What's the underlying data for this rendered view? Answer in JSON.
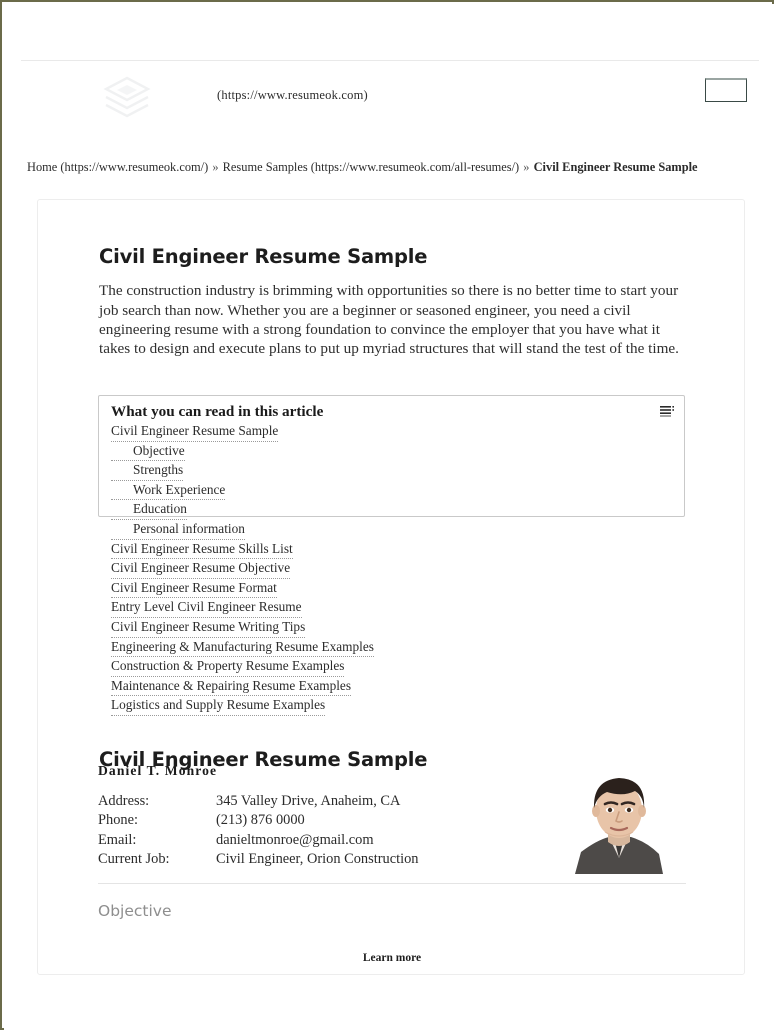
{
  "site": {
    "logo_icon": "stacked-layers-logo",
    "url_text": "(https://www.resumeok.com)",
    "menu_button_label": ""
  },
  "breadcrumb": {
    "items": [
      {
        "label": "Home (https://www.resumeok.com/)",
        "current": false
      },
      {
        "label": "Resume Samples (https://www.resumeok.com/all-resumes/)",
        "current": false
      },
      {
        "label": "Civil Engineer Resume Sample",
        "current": true
      }
    ],
    "separator": "»"
  },
  "article": {
    "title": "Civil Engineer Resume Sample",
    "intro": "The construction industry is brimming with opportunities so there is no better time to start your job search than now. Whether you are a beginner or seasoned engineer, you need a civil engineering resume with a strong foundation to convince the employer that you have what it takes to design and execute plans to put up myriad structures that will stand the test of the time."
  },
  "toc": {
    "title": "What you can read in this article",
    "toggle_icon": "list-toggle-icon",
    "items": [
      {
        "label": "Civil Engineer Resume Sample",
        "level": 1
      },
      {
        "label": "Objective",
        "level": 2
      },
      {
        "label": "Strengths",
        "level": 2
      },
      {
        "label": "Work Experience",
        "level": 2
      },
      {
        "label": "Education",
        "level": 2
      },
      {
        "label": "Personal information",
        "level": 2
      },
      {
        "label": "Civil Engineer Resume Skills List",
        "level": 1
      },
      {
        "label": "Civil Engineer Resume Objective",
        "level": 1
      },
      {
        "label": "Civil Engineer Resume Format",
        "level": 1
      },
      {
        "label": "Entry Level Civil Engineer Resume",
        "level": 1
      },
      {
        "label": "Civil Engineer Resume Writing Tips",
        "level": 1
      },
      {
        "label": "Engineering & Manufacturing Resume Examples",
        "level": 1
      },
      {
        "label": "Construction & Property Resume Examples",
        "level": 1
      },
      {
        "label": "Maintenance & Repairing Resume Examples",
        "level": 1
      },
      {
        "label": "Logistics and Supply Resume Examples",
        "level": 1
      }
    ]
  },
  "resume": {
    "section_title": "Civil Engineer Resume Sample",
    "name": "Daniel T. Monroe",
    "photo_alt": "headshot-photo",
    "contact": [
      {
        "label": "Address:",
        "value": "345 Valley Drive, Anaheim, CA"
      },
      {
        "label": "Phone:",
        "value": "(213) 876 0000"
      },
      {
        "label": "Email:",
        "value": "danieltmonroe@gmail.com"
      },
      {
        "label": "Current Job:",
        "value": "Civil Engineer, Orion Construction"
      }
    ],
    "objective_heading": "Objective"
  },
  "footer": {
    "learn_more": "Learn more"
  },
  "colors": {
    "page_border": "#6b6b4a",
    "card_border": "#ededed",
    "toc_border": "#c9c9c9",
    "text": "#2b2b2b",
    "muted": "#8e8e8e"
  }
}
